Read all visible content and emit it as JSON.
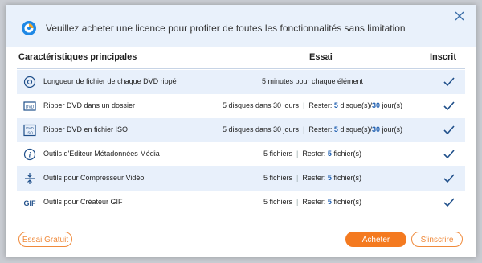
{
  "header": {
    "message": "Veuillez acheter une licence pour profiter de toutes les fonctionnalités sans limitation"
  },
  "table": {
    "col_features": "Caractéristiques principales",
    "col_trial": "Essai",
    "col_registered": "Inscrit",
    "rows": [
      {
        "icon": "info-circle-icon",
        "feature": "Longueur de fichier de chaque DVD rippé",
        "trial_text": "5 minutes pour chaque élément"
      },
      {
        "icon": "dvd-folder-icon",
        "feature": "Ripper DVD dans un dossier",
        "trial_a": "5 disques dans 30 jours",
        "rest_label": "Rester:",
        "rest_n1": "5",
        "rest_u1": "disque(s)/",
        "rest_n2": "30",
        "rest_u2": "jour(s)"
      },
      {
        "icon": "dvd-iso-icon",
        "feature": "Ripper DVD en fichier ISO",
        "trial_a": "5 disques dans 30 jours",
        "rest_label": "Rester:",
        "rest_n1": "5",
        "rest_u1": "disque(s)/",
        "rest_n2": "30",
        "rest_u2": "jour(s)"
      },
      {
        "icon": "info-icon",
        "feature": "Outils d'Éditeur Métadonnées Média",
        "trial_a": "5 fichiers",
        "rest_label": "Rester:",
        "rest_n1": "5",
        "rest_u1": "fichier(s)"
      },
      {
        "icon": "compress-icon",
        "feature": "Outils pour Compresseur Vidéo",
        "trial_a": "5 fichiers",
        "rest_label": "Rester:",
        "rest_n1": "5",
        "rest_u1": "fichier(s)"
      },
      {
        "icon": "gif-icon",
        "feature": "Outils pour Créateur GIF",
        "trial_a": "5 fichiers",
        "rest_label": "Rester:",
        "rest_n1": "5",
        "rest_u1": "fichier(s)"
      }
    ]
  },
  "buttons": {
    "free_trial": "Essai Gratuit",
    "buy": "Acheter",
    "register": "S'inscrire"
  },
  "colors": {
    "accent": "#f47a20",
    "blue": "#1f5fb0",
    "header_bg": "#e9f1fb",
    "row_alt": "#e8f0fb"
  }
}
